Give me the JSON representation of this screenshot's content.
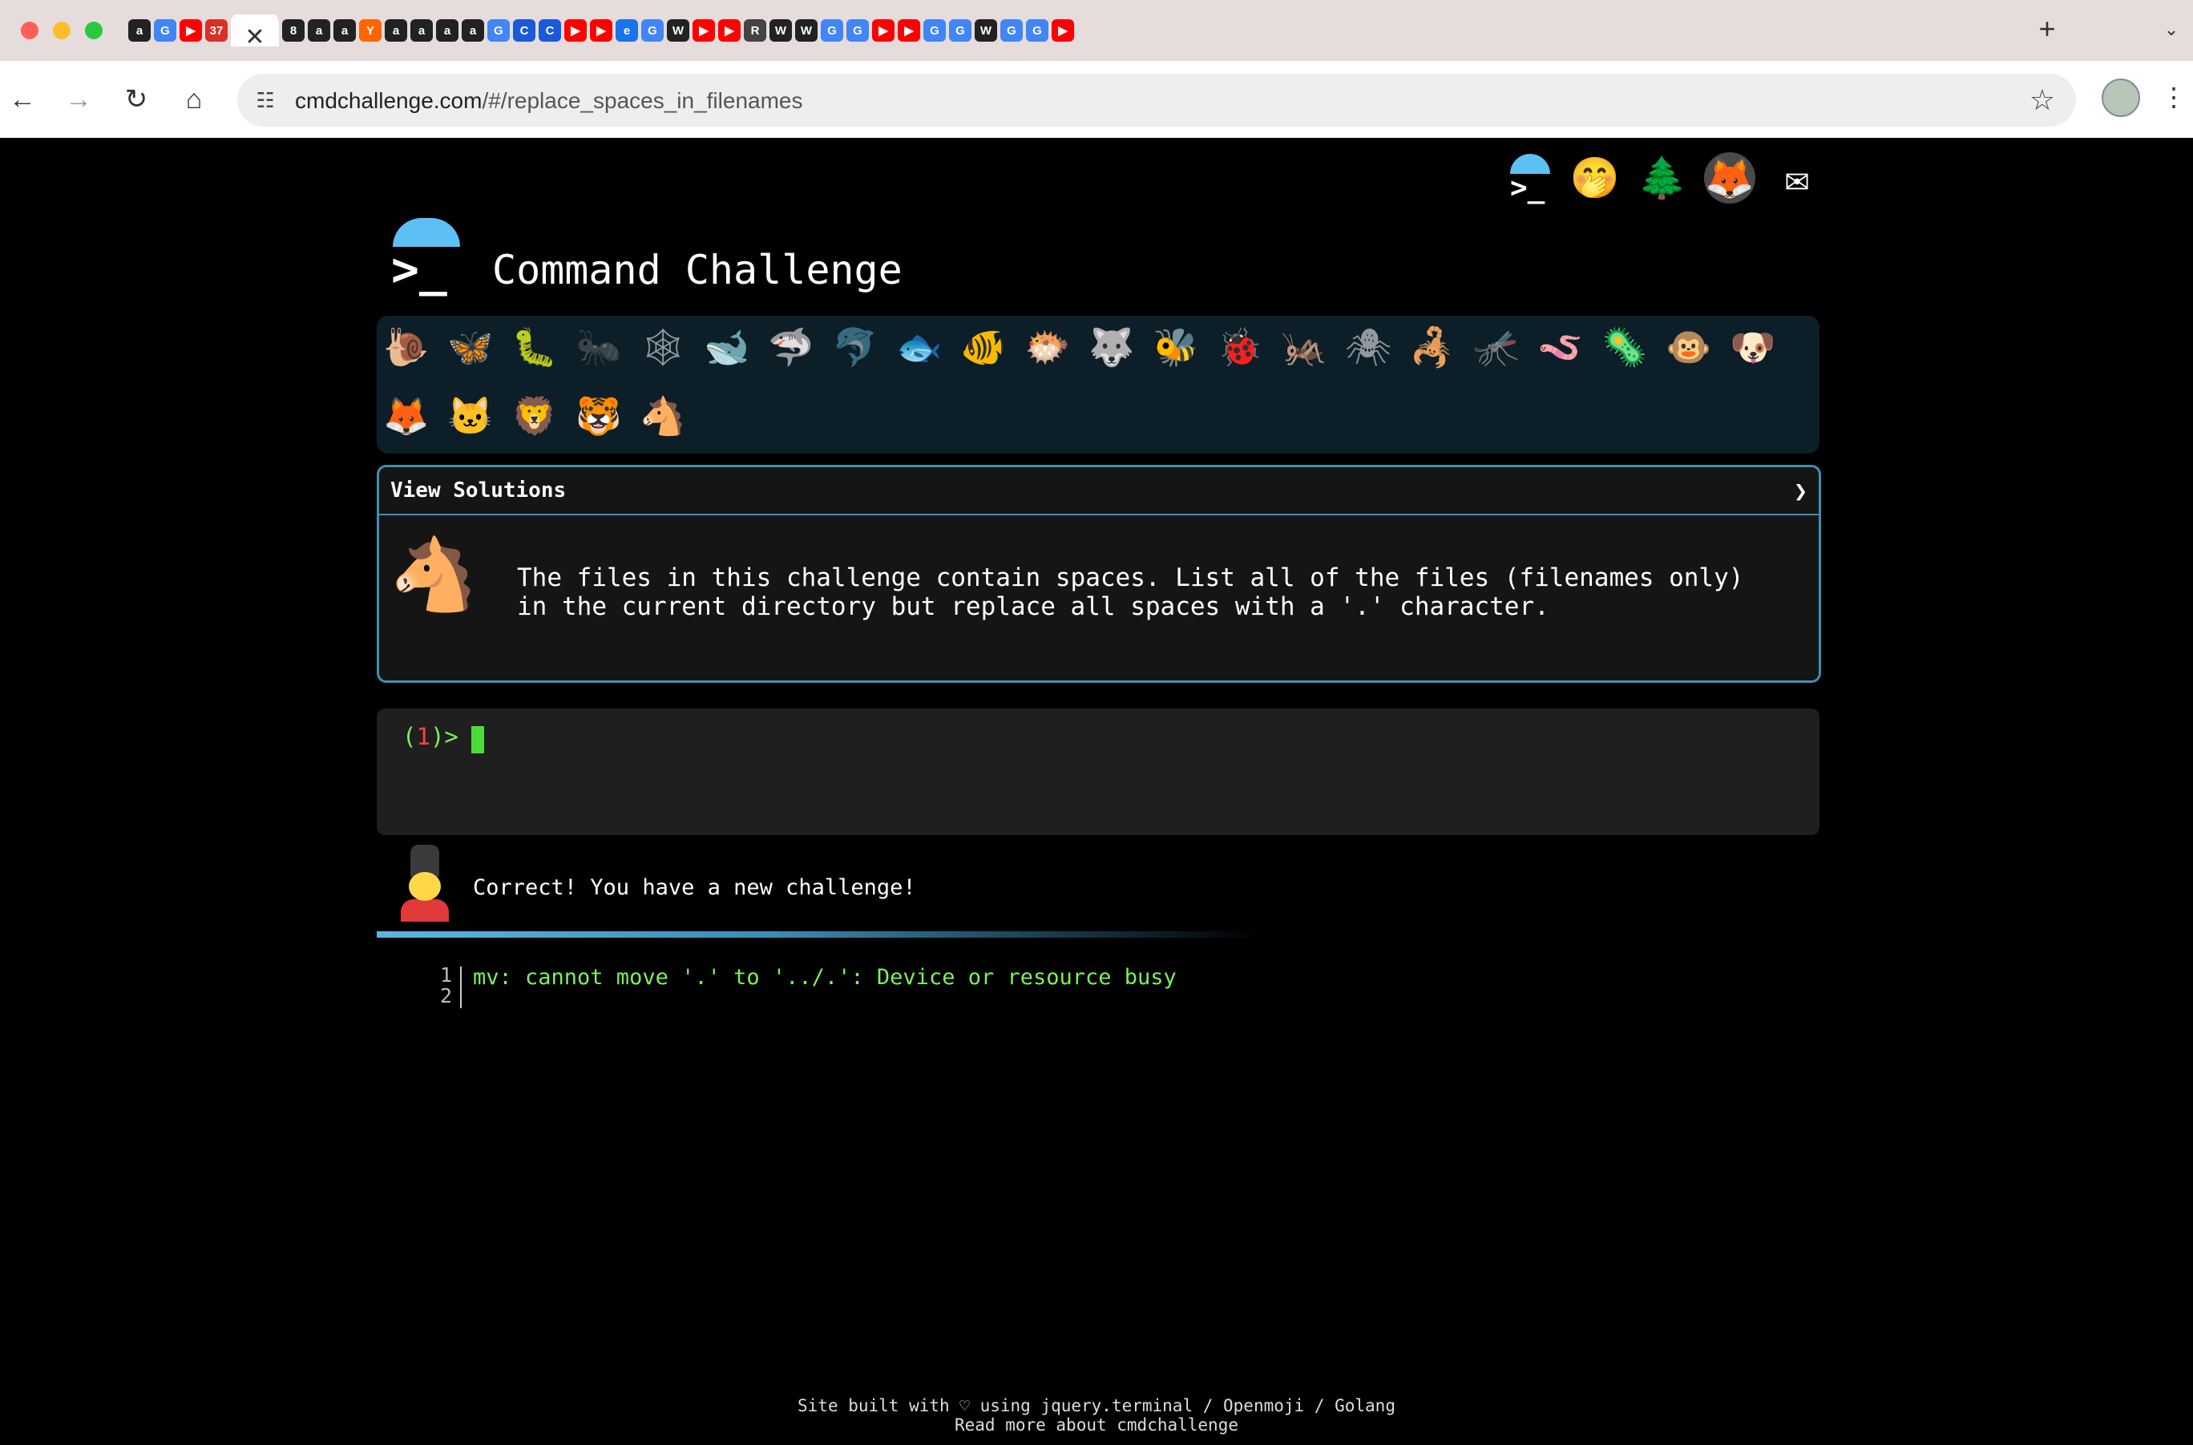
{
  "browser": {
    "url_host": "cmdchallenge.com",
    "url_path": "/#/replace_spaces_in_filenames",
    "tabs": [
      {
        "glyph": "G",
        "color": "#4285f4"
      },
      {
        "glyph": "▶",
        "color": "#ff0000"
      },
      {
        "glyph": "37",
        "color": "#d93025"
      },
      {
        "glyph": "8",
        "color": "#222"
      },
      {
        "glyph": "a",
        "color": "#222"
      },
      {
        "glyph": "a",
        "color": "#222"
      },
      {
        "glyph": "a",
        "color": "#222"
      },
      {
        "glyph": "Y",
        "color": "#ff6600"
      },
      {
        "glyph": "a",
        "color": "#222"
      },
      {
        "glyph": "a",
        "color": "#222"
      },
      {
        "glyph": "a",
        "color": "#222"
      },
      {
        "glyph": "a",
        "color": "#222"
      },
      {
        "glyph": "G",
        "color": "#4285f4"
      },
      {
        "glyph": "C",
        "color": "#1a5ad9"
      },
      {
        "glyph": "C",
        "color": "#1a5ad9"
      },
      {
        "glyph": "▶",
        "color": "#ff0000"
      },
      {
        "glyph": "▶",
        "color": "#ff0000"
      },
      {
        "glyph": "e",
        "color": "#1a73e8"
      },
      {
        "glyph": "G",
        "color": "#4285f4"
      },
      {
        "glyph": "W",
        "color": "#222"
      },
      {
        "glyph": "▶",
        "color": "#ff0000"
      },
      {
        "glyph": "▶",
        "color": "#ff0000"
      },
      {
        "glyph": "R",
        "color": "#444"
      },
      {
        "glyph": "W",
        "color": "#222"
      },
      {
        "glyph": "W",
        "color": "#222"
      },
      {
        "glyph": "G",
        "color": "#4285f4"
      },
      {
        "glyph": "G",
        "color": "#4285f4"
      },
      {
        "glyph": "▶",
        "color": "#ff0000"
      },
      {
        "glyph": "▶",
        "color": "#ff0000"
      },
      {
        "glyph": "G",
        "color": "#4285f4"
      },
      {
        "glyph": "G",
        "color": "#4285f4"
      },
      {
        "glyph": "W",
        "color": "#222"
      },
      {
        "glyph": "G",
        "color": "#4285f4"
      },
      {
        "glyph": "G",
        "color": "#4285f4"
      },
      {
        "glyph": "▶",
        "color": "#ff0000"
      }
    ],
    "active_tab_close": "✕",
    "new_tab": "+"
  },
  "top_icons": [
    {
      "name": "terminal-logo-icon",
      "glyph": ""
    },
    {
      "name": "hand-over-mouth-icon",
      "glyph": "🤭"
    },
    {
      "name": "tree-icon",
      "glyph": "🌲"
    },
    {
      "name": "gitlab-fox-icon",
      "glyph": "🦊"
    },
    {
      "name": "envelope-icon",
      "glyph": "✉"
    }
  ],
  "header": {
    "title": "Command Challenge",
    "logo_glyph": ">_"
  },
  "badges": [
    {
      "glyph": "🐌",
      "state": "done"
    },
    {
      "glyph": "🦋",
      "state": "done"
    },
    {
      "glyph": "🐛",
      "state": "done"
    },
    {
      "glyph": "🐜",
      "state": "locked"
    },
    {
      "glyph": "🕸",
      "state": "locked"
    },
    {
      "glyph": "🐋",
      "state": "done"
    },
    {
      "glyph": "🦈",
      "state": "done"
    },
    {
      "glyph": "🐬",
      "state": "locked"
    },
    {
      "glyph": "🐟",
      "state": "done"
    },
    {
      "glyph": "🐠",
      "state": "done"
    },
    {
      "glyph": "🐡",
      "state": "done"
    },
    {
      "glyph": "🐺",
      "state": "done"
    },
    {
      "glyph": "🐝",
      "state": "done"
    },
    {
      "glyph": "🐞",
      "state": "done"
    },
    {
      "glyph": "🦗",
      "state": "done"
    },
    {
      "glyph": "🕷",
      "state": "locked"
    },
    {
      "glyph": "🦂",
      "state": "done"
    },
    {
      "glyph": "🦟",
      "state": "done"
    },
    {
      "glyph": "🪱",
      "state": "done"
    },
    {
      "glyph": "🦠",
      "state": "done"
    },
    {
      "glyph": "🐵",
      "state": "done"
    },
    {
      "glyph": "🐶",
      "state": "done"
    },
    {
      "glyph": "🦊",
      "state": "done"
    },
    {
      "glyph": "🐱",
      "state": "done"
    },
    {
      "glyph": "🦁",
      "state": "done"
    },
    {
      "glyph": "🐯",
      "state": "done"
    },
    {
      "glyph": "🐴",
      "state": "done"
    }
  ],
  "solutions": {
    "label": "View Solutions",
    "chevron": "❯",
    "animal_glyph": "🐴",
    "challenge_text": "The files in this challenge contain spaces. List all of the files (filenames only)\nin the current directory but replace all spaces with a '.' character."
  },
  "terminal": {
    "prompt_open": "(",
    "prompt_num": "1",
    "prompt_close": ")>"
  },
  "message": {
    "text": "Correct! You have a new challenge!"
  },
  "output": {
    "line_numbers": "1\n2",
    "line": "mv: cannot move '.' to '../.': Device or resource busy"
  },
  "footer": {
    "line1": "Site built with ♡ using jquery.terminal / Openmoji / Golang",
    "line2": "Read more about cmdchallenge"
  }
}
